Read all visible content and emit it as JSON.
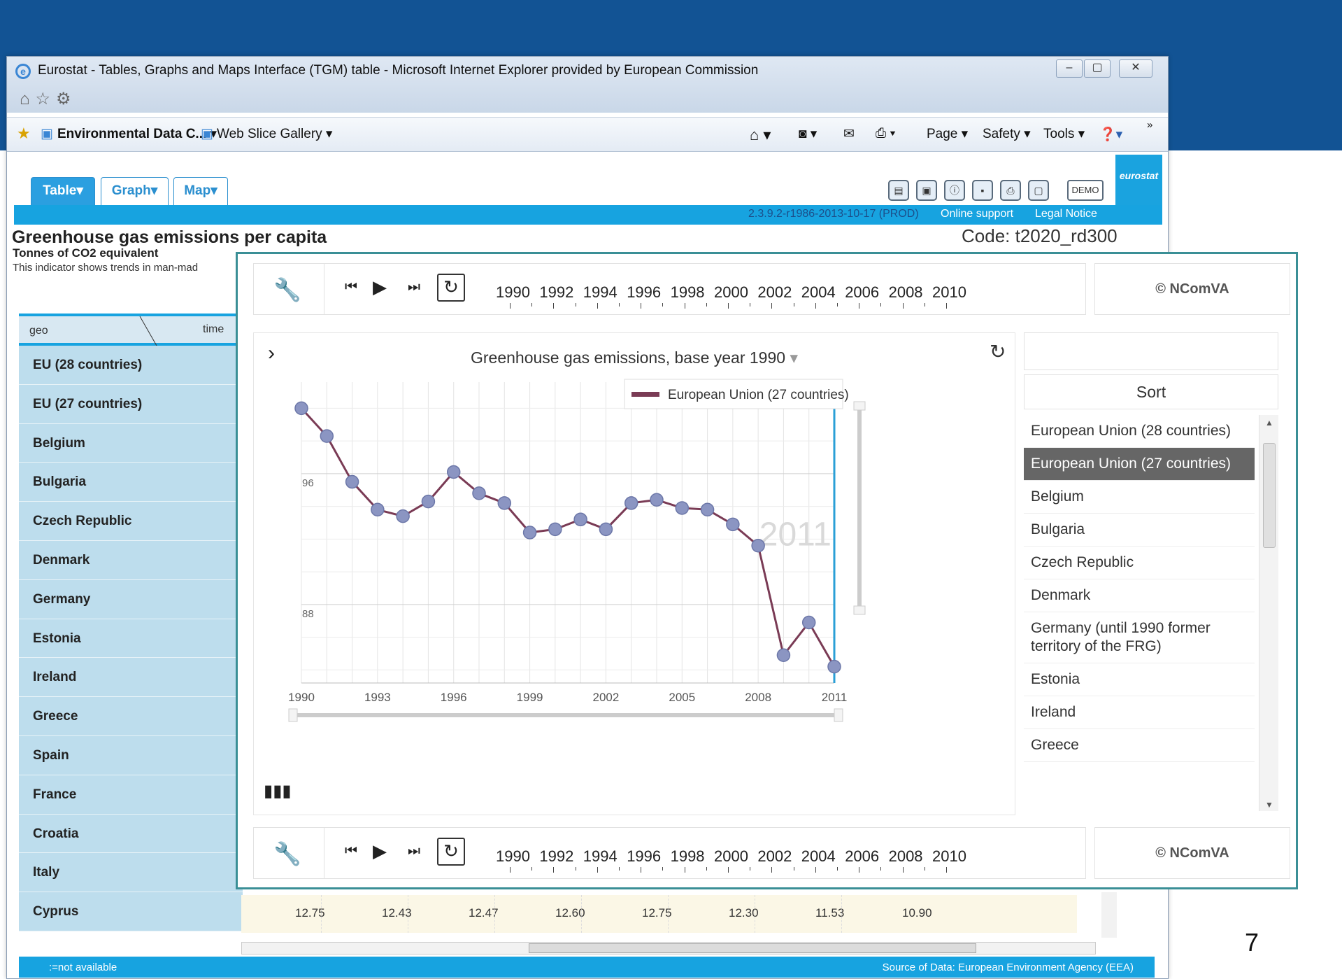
{
  "slide": {
    "page_number": "7"
  },
  "window": {
    "title": "Eurostat - Tables, Graphs and Maps Interface (TGM) table - Microsoft Internet Explorer provided by European Commission",
    "minimize": "–",
    "maximize": "▢",
    "close": "✕"
  },
  "favorites": {
    "item1": "Environmental Data C...",
    "item2": "Web Slice Gallery",
    "page": "Page",
    "safety": "Safety",
    "tools": "Tools",
    "more": "»"
  },
  "app": {
    "tabs": [
      "Table",
      "Graph",
      "Map"
    ],
    "version": "2.3.9.2-r1986-2013-10-17 (PROD)",
    "online_support": "Online support",
    "legal_notice": "Legal Notice",
    "demo": "DEMO",
    "logo": "eurostat",
    "title": "Greenhouse gas emissions per capita",
    "code": "Code: t2020_rd300",
    "subtitle": "Tonnes of CO2 equivalent",
    "description": "This indicator shows trends in man-mad"
  },
  "table": {
    "geo_header": "geo",
    "time_header": "time",
    "rows": [
      "EU (28 countries)",
      "EU (27 countries)",
      "Belgium",
      "Bulgaria",
      "Czech Republic",
      "Denmark",
      "Germany",
      "Estonia",
      "Ireland",
      "Greece",
      "Spain",
      "France",
      "Croatia",
      "Italy",
      "Cyprus"
    ],
    "cyprus_values": [
      "12.75",
      "12.43",
      "12.47",
      "12.60",
      "12.75",
      "12.30",
      "11.53",
      "10.90"
    ],
    "footer_left": ":=not available",
    "footer_right": "Source of Data: European Environment Agency (EEA)"
  },
  "viz": {
    "ncomva": "© NComVA",
    "timeline_years": [
      "1990",
      "1992",
      "1994",
      "1996",
      "1998",
      "2000",
      "2002",
      "2004",
      "2006",
      "2008",
      "2010"
    ],
    "sort_label": "Sort",
    "countries": [
      "European Union (28 countries)",
      "European Union (27 countries)",
      "Belgium",
      "Bulgaria",
      "Czech Republic",
      "Denmark",
      "Germany (until 1990 former territory of the FRG)",
      "Estonia",
      "Ireland",
      "Greece"
    ],
    "selected_country_index": 1,
    "current_year_watermark": "2011"
  },
  "chart_data": {
    "type": "line",
    "title": "Greenhouse gas emissions, base year 1990",
    "xlabel": "",
    "ylabel": "",
    "x_ticks": [
      "1990",
      "1993",
      "1996",
      "1999",
      "2002",
      "2005",
      "2008",
      "2011"
    ],
    "y_ticks": [
      "96",
      "88"
    ],
    "xlim": [
      1990,
      2011
    ],
    "ylim": [
      83.2,
      101.6
    ],
    "grid": true,
    "legend_position": "top-right",
    "series": [
      {
        "name": "European Union (27 countries)",
        "color": "#7a3b55",
        "marker_color": "#8b95c2",
        "x": [
          1990,
          1991,
          1992,
          1993,
          1994,
          1995,
          1996,
          1997,
          1998,
          1999,
          2000,
          2001,
          2002,
          2003,
          2004,
          2005,
          2006,
          2007,
          2008,
          2009,
          2010,
          2011
        ],
        "y": [
          100.0,
          98.3,
          95.5,
          93.8,
          93.4,
          94.3,
          96.1,
          94.8,
          94.2,
          92.4,
          92.6,
          93.2,
          92.6,
          94.2,
          94.4,
          93.9,
          93.8,
          92.9,
          91.6,
          84.9,
          86.9,
          84.2
        ]
      }
    ]
  }
}
